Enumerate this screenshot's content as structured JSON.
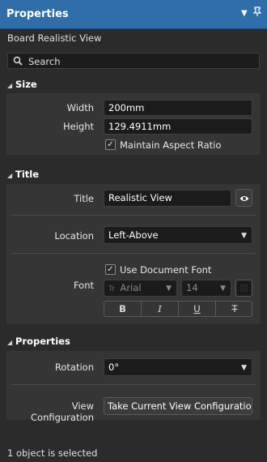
{
  "panel": {
    "title": "Properties",
    "subtitle": "Board Realistic View",
    "status": "1 object is selected"
  },
  "search": {
    "placeholder": "Search"
  },
  "size": {
    "header": "Size",
    "width_label": "Width",
    "width_value": "200mm",
    "height_label": "Height",
    "height_value": "129.4911mm",
    "maintain_aspect_label": "Maintain Aspect Ratio",
    "maintain_aspect_checked": true
  },
  "title_section": {
    "header": "Title",
    "title_label": "Title",
    "title_value": "Realistic View",
    "location_label": "Location",
    "location_value": "Left-Above",
    "font_label": "Font",
    "use_doc_font_label": "Use Document Font",
    "use_doc_font_checked": true,
    "font_family": "Arial",
    "font_size": "14",
    "format_buttons": [
      "B",
      "I",
      "U",
      "T"
    ]
  },
  "properties_section": {
    "header": "Properties",
    "rotation_label": "Rotation",
    "rotation_value": "0°",
    "view_config_label": "View Configuration",
    "view_config_button": "Take Current View Configuratio"
  },
  "colors": {
    "titlebar": "#2f6ea8",
    "panel_bg": "#2b2b2b",
    "section_bg": "#353535",
    "field_bg": "#1b1b1b"
  },
  "icons": {
    "search": "search-icon",
    "dropdown": "triangle-down-icon",
    "pin": "pin-icon",
    "close": "close-icon",
    "eye": "eye-icon",
    "color_swatch": "color-swatch"
  }
}
